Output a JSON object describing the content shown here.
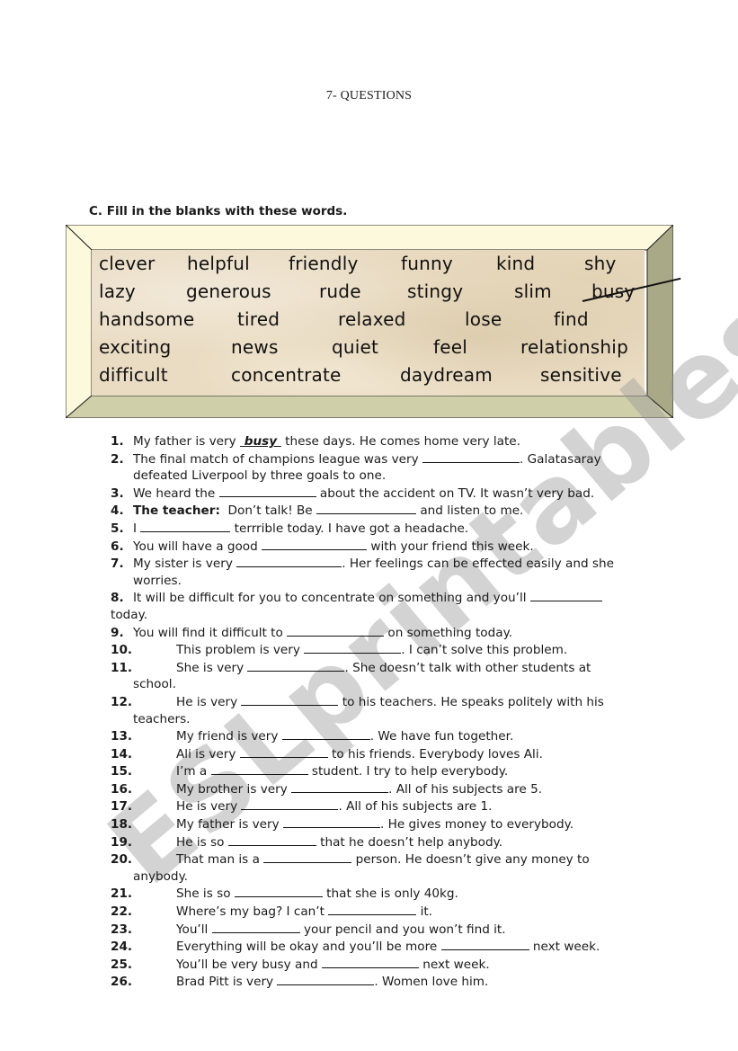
{
  "page_title": "7- QUESTIONS",
  "instruction": "C. Fill in the blanks with these words.",
  "word_bank": {
    "rows": [
      [
        "clever",
        "helpful",
        "friendly",
        "funny",
        "kind",
        "shy"
      ],
      [
        "lazy",
        "generous",
        "rude",
        "stingy",
        "slim",
        "busy"
      ],
      [
        "handsome",
        "tired",
        "relaxed",
        "lose",
        "find"
      ],
      [
        "exciting",
        "news",
        "quiet",
        "feel",
        "relationship"
      ],
      [
        "difficult",
        "concentrate",
        "daydream",
        "sensitive"
      ]
    ],
    "crossed_out": "busy"
  },
  "questions": [
    {
      "num": "1.",
      "before": "My father is very ",
      "answer": "busy",
      "after": " these days. He comes home very late."
    },
    {
      "num": "2.",
      "before": "The final match of champions league was very ",
      "after": ". Galatasaray",
      "cont": "defeated Liverpool by three goals to one."
    },
    {
      "num": "3.",
      "before": "We heard the ",
      "after": " about the accident on TV. It wasn’t very bad."
    },
    {
      "num": "4.",
      "lead": "The teacher:",
      "before": "  Don’t talk! Be ",
      "after": " and listen to me."
    },
    {
      "num": "5.",
      "before": "I ",
      "after": " terrrible today. I have got a headache."
    },
    {
      "num": "6.",
      "before": "You will have a good ",
      "after": " with your friend this week."
    },
    {
      "num": "7.",
      "before": "My sister is very ",
      "after": ". Her feelings can be effected easily and she",
      "cont": "worries."
    },
    {
      "num": "8.",
      "before": "It will be difficult for you to concentrate on something and you’ll ",
      "after": "",
      "cont": "today."
    },
    {
      "num": "9.",
      "before": "You will find it difficult to ",
      "after": " on something today."
    },
    {
      "num": "10.",
      "before": "This problem is very ",
      "after": ". I can’t solve this problem."
    },
    {
      "num": "11.",
      "before": "She is very ",
      "after": ". She doesn’t talk with other students at",
      "cont": "school."
    },
    {
      "num": "12.",
      "before": "He is very ",
      "after": " to his teachers. He speaks politely with his",
      "cont": "teachers."
    },
    {
      "num": "13.",
      "before": "My friend is very ",
      "after": ". We have fun together."
    },
    {
      "num": "14.",
      "before": "Ali is very ",
      "after": " to his friends. Everybody loves Ali."
    },
    {
      "num": "15.",
      "before": "I’m a ",
      "after": " student. I try to help everybody."
    },
    {
      "num": "16.",
      "before": "My brother is very ",
      "after": ". All of his subjects are 5."
    },
    {
      "num": "17.",
      "before": "He is very ",
      "after": ". All of his subjects are 1."
    },
    {
      "num": "18.",
      "before": "My father is very ",
      "after": ". He gives money to everybody."
    },
    {
      "num": "19.",
      "before": "He is so ",
      "after": " that he doesn’t help anybody."
    },
    {
      "num": "20.",
      "before": "That man is a ",
      "after": " person. He doesn’t give any money to",
      "cont": "anybody."
    },
    {
      "num": "21.",
      "before": "She is so ",
      "after": " that she is only 40kg."
    },
    {
      "num": "22.",
      "before": "Where’s my bag? I can’t ",
      "after": " it."
    },
    {
      "num": "23.",
      "before": "You’ll ",
      "after": " your pencil and you won’t find it."
    },
    {
      "num": "24.",
      "before": "Everything will be okay and you’ll be more ",
      "after": " next week."
    },
    {
      "num": "25.",
      "before": "You’ll be very busy and ",
      "after": " next week."
    },
    {
      "num": "26.",
      "before": "Brad Pitt is very ",
      "after": ". Women love him."
    }
  ],
  "watermark": "ESLprintables.com"
}
